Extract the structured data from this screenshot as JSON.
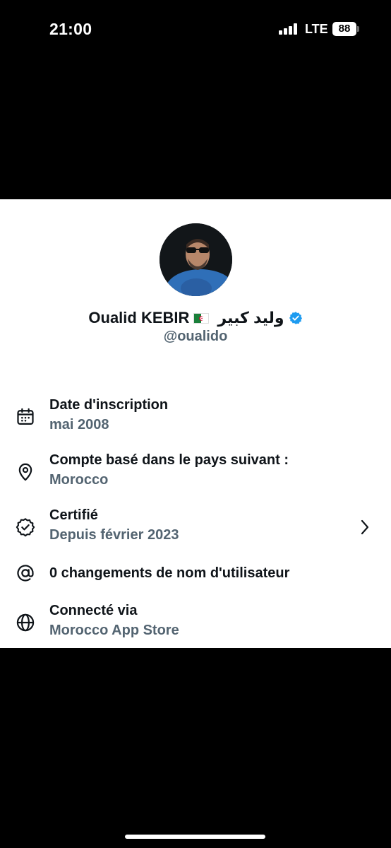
{
  "status_bar": {
    "time": "21:00",
    "network": "LTE",
    "battery": "88"
  },
  "profile": {
    "display_name": "Oualid KEBIR",
    "display_name_ar": "وليد كبير",
    "flag_icon": "algeria-flag",
    "verified_icon": "verified-badge",
    "handle": "@oualido",
    "accent_color": "#1d9bf0"
  },
  "about": [
    {
      "icon": "calendar-icon",
      "title": "Date d'inscription",
      "value": "mai 2008"
    },
    {
      "icon": "location-pin-icon",
      "title": "Compte basé dans le pays suivant :",
      "value": "Morocco"
    },
    {
      "icon": "verified-outline-icon",
      "title": "Certifié",
      "value": "Depuis février 2023"
    },
    {
      "icon": "at-sign-icon",
      "title": "0 changements de nom d'utilisateur"
    },
    {
      "icon": "globe-icon",
      "title": "Connecté via",
      "value": "Morocco App Store"
    }
  ]
}
